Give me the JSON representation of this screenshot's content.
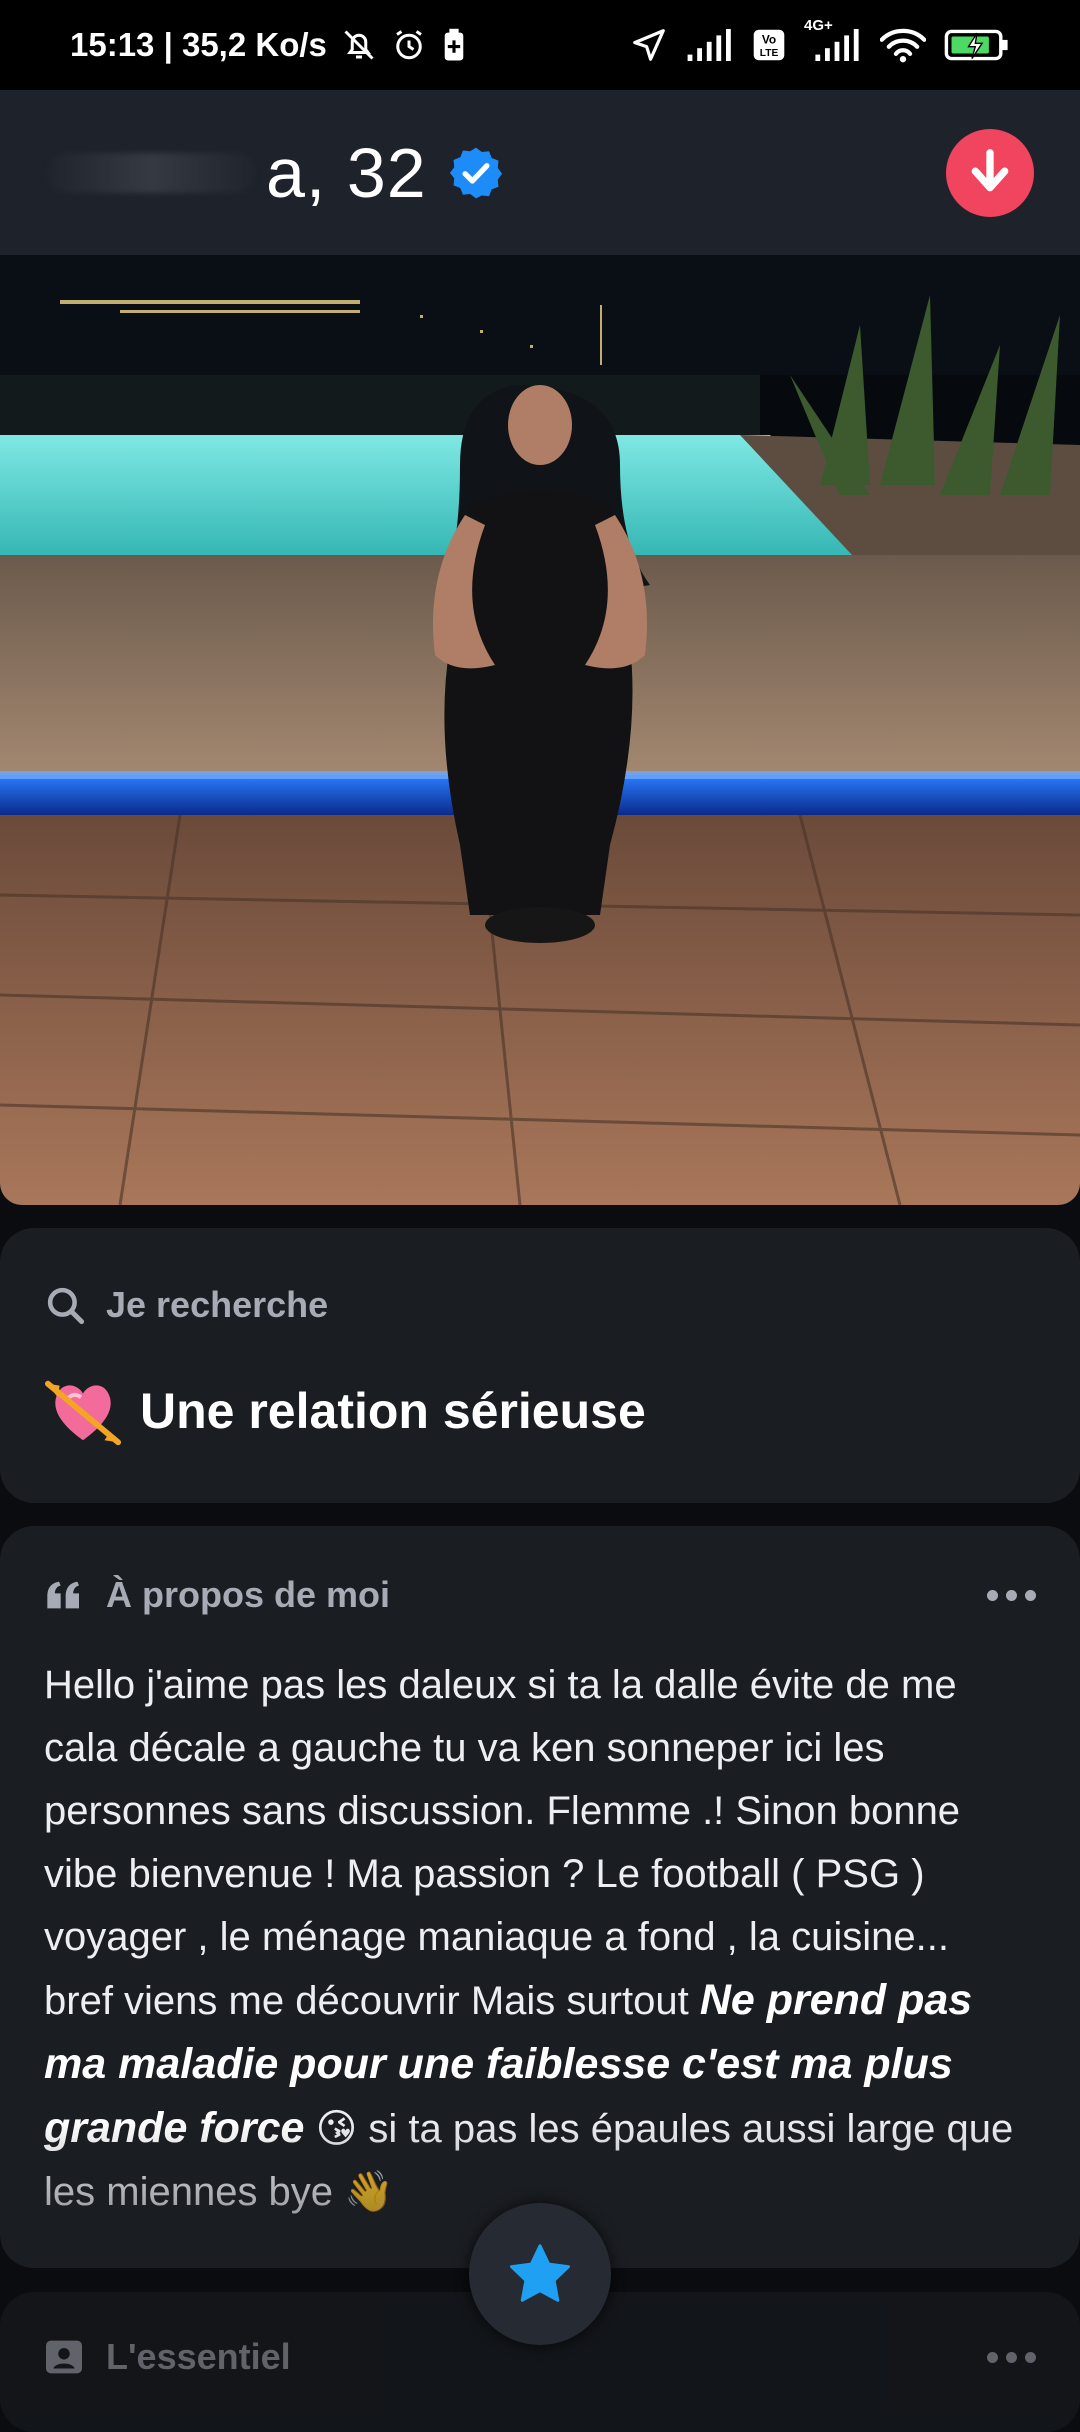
{
  "status_bar": {
    "time_speed": "15:13 | 35,2 Ko/s",
    "volte": "Vo LTE",
    "network": "4G+"
  },
  "profile": {
    "name_visible": "a, 32",
    "accent": "#f1445e"
  },
  "looking_for": {
    "label": "Je recherche",
    "value": "Une relation sérieuse"
  },
  "about": {
    "label": "À propos de moi",
    "text_intro": "Hello j'aime pas les daleux si ta la dalle évite de me cala décale a gauche tu va ken sonneper ici les personnes sans discussion. Flemme .! Sinon bonne vibe bienvenue ! Ma passion ? Le football ( PSG ) voyager , le ménage maniaque a fond , la cuisine... bref viens me découvrir  Mais surtout ",
    "text_bold": "Ne prend pas ma maladie pour une faiblesse c'est ma plus grande force",
    "text_tail": " 😘 si ta pas les épaules aussi large que les miennes bye 👋"
  },
  "essentials": {
    "label": "L'essentiel"
  },
  "icons": {
    "verified": "verified-badge-icon",
    "down": "arrow-down-icon",
    "search": "search-icon",
    "heart": "heart-arrow-icon",
    "quote": "quote-icon",
    "more": "more-dots-icon",
    "star": "star-icon",
    "id": "id-card-icon"
  }
}
